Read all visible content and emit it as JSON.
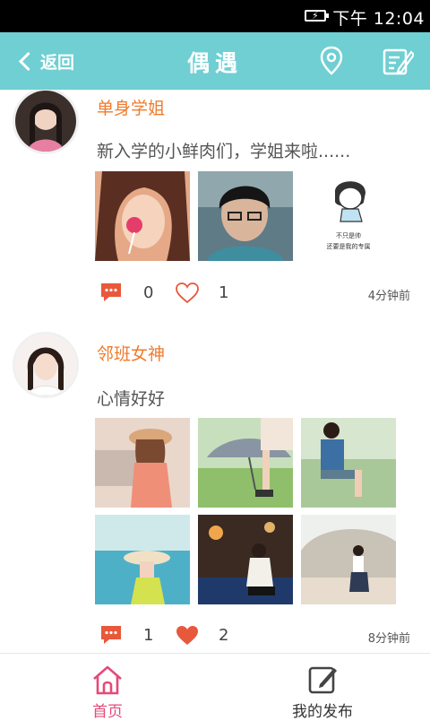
{
  "status_bar": {
    "time": "下午 12:04"
  },
  "header": {
    "back_label": "返回",
    "title": "偶遇"
  },
  "colors": {
    "header_bg": "#6fcfd2",
    "username": "#f07b2c",
    "icon_accent": "#e8583a",
    "active_tab": "#e44a7a"
  },
  "posts": [
    {
      "username": "单身学姐",
      "content": "新入学的小鲜肉们，学姐来啦......",
      "comment_count": "0",
      "like_count": "1",
      "liked": false,
      "time": "4分钟前",
      "sketch_caption": "不只是帅\n还要是我的专属"
    },
    {
      "username": "邻班女神",
      "content": "心情好好",
      "comment_count": "1",
      "like_count": "2",
      "liked": true,
      "time": "8分钟前"
    }
  ],
  "bottom_nav": {
    "home_label": "首页",
    "mine_label": "我的发布"
  }
}
